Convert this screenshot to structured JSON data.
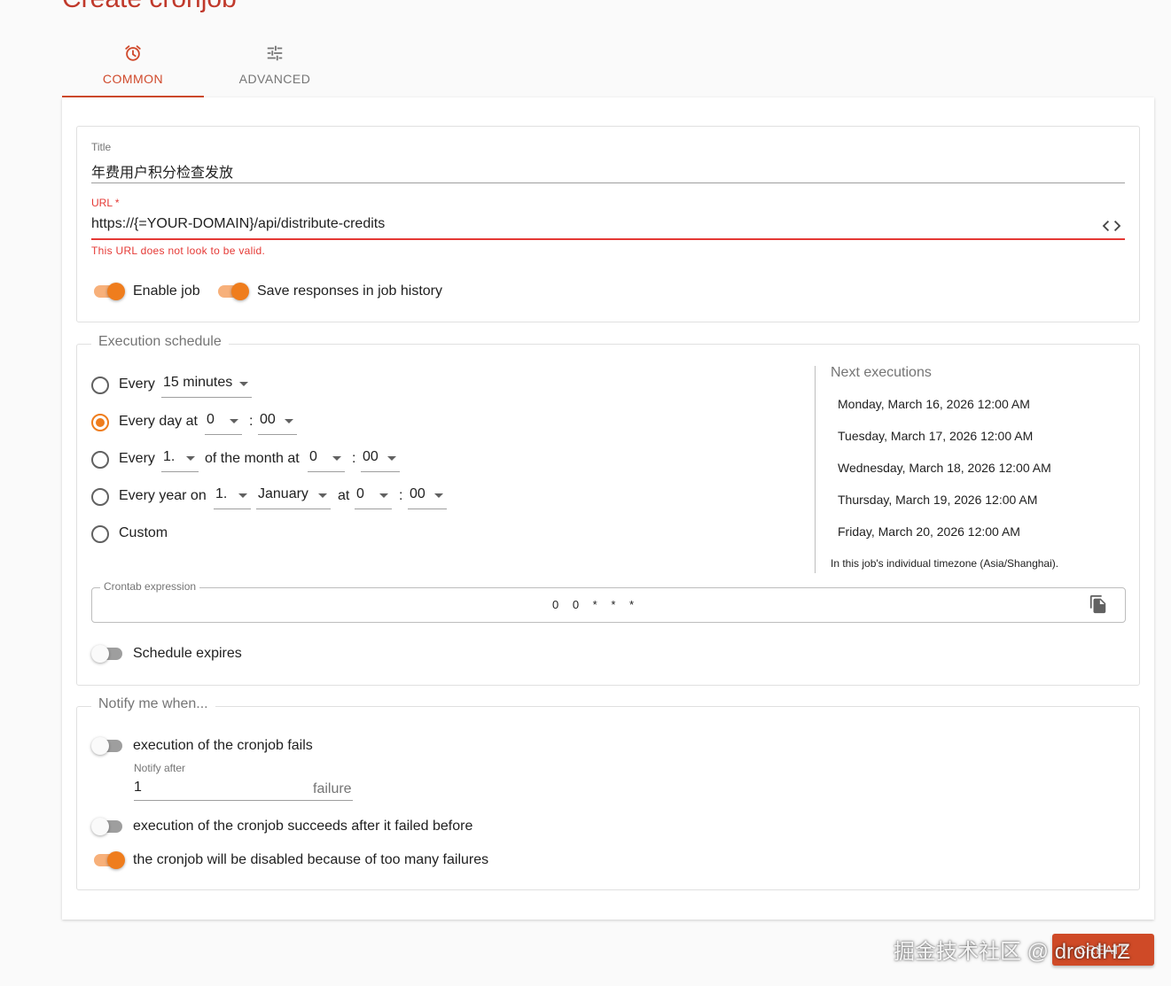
{
  "page": {
    "title": "Create cronjob"
  },
  "tabs": [
    {
      "label": "COMMON",
      "icon": "alarm-icon",
      "active": true
    },
    {
      "label": "ADVANCED",
      "icon": "tune-icon",
      "active": false
    }
  ],
  "common": {
    "title_field": {
      "label": "Title",
      "value": "年费用户积分检查发放"
    },
    "url_field": {
      "label": "URL *",
      "value": "https://{=YOUR-DOMAIN}/api/distribute-credits",
      "error": "This URL does not look to be valid.",
      "icon": "code-icon"
    },
    "enable_job": {
      "label": "Enable job",
      "on": true
    },
    "save_responses": {
      "label": "Save responses in job history",
      "on": true
    }
  },
  "schedule": {
    "legend": "Execution schedule",
    "options": {
      "every_minutes": {
        "prefix": "Every",
        "select": "15 minutes",
        "checked": false
      },
      "every_day": {
        "prefix": "Every day at",
        "hour": "0",
        "sep": ":",
        "minute": "00",
        "checked": true
      },
      "every_month": {
        "prefix": "Every",
        "day": "1.",
        "mid": "of the month at",
        "hour": "0",
        "sep": ":",
        "minute": "00",
        "checked": false
      },
      "every_year": {
        "prefix": "Every year on",
        "day": "1.",
        "month": "January",
        "at": "at",
        "hour": "0",
        "sep": ":",
        "minute": "00",
        "checked": false
      },
      "custom": {
        "label": "Custom",
        "checked": false
      }
    },
    "next_executions": {
      "title": "Next executions",
      "items": [
        "Monday, March 16, 2026 12:00 AM",
        "Tuesday, March 17, 2026 12:00 AM",
        "Wednesday, March 18, 2026 12:00 AM",
        "Thursday, March 19, 2026 12:00 AM",
        "Friday, March 20, 2026 12:00 AM"
      ],
      "timezone_note": "In this job's individual timezone (Asia/Shanghai)."
    },
    "crontab": {
      "label": "Crontab expression",
      "value": "0 0 * * *",
      "icon": "copy-icon"
    },
    "expires": {
      "label": "Schedule expires",
      "on": false
    }
  },
  "notify": {
    "legend": "Notify me when...",
    "fails": {
      "label": "execution of the cronjob fails",
      "on": false
    },
    "notify_after": {
      "label": "Notify after",
      "value": "1",
      "suffix": "failure"
    },
    "succeeds_after_fail": {
      "label": "execution of the cronjob succeeds after it failed before",
      "on": false
    },
    "disabled": {
      "label": "the cronjob will be disabled because of too many failures",
      "on": true
    }
  },
  "footer": {
    "button_label": "CREATE",
    "watermark": "掘金技术社区 @ droidHZ"
  },
  "colors": {
    "accent": "#ef7d1d",
    "title": "#c0392b",
    "tab_active": "#d04a2c",
    "error": "#e53935",
    "button": "#cf4a27"
  }
}
